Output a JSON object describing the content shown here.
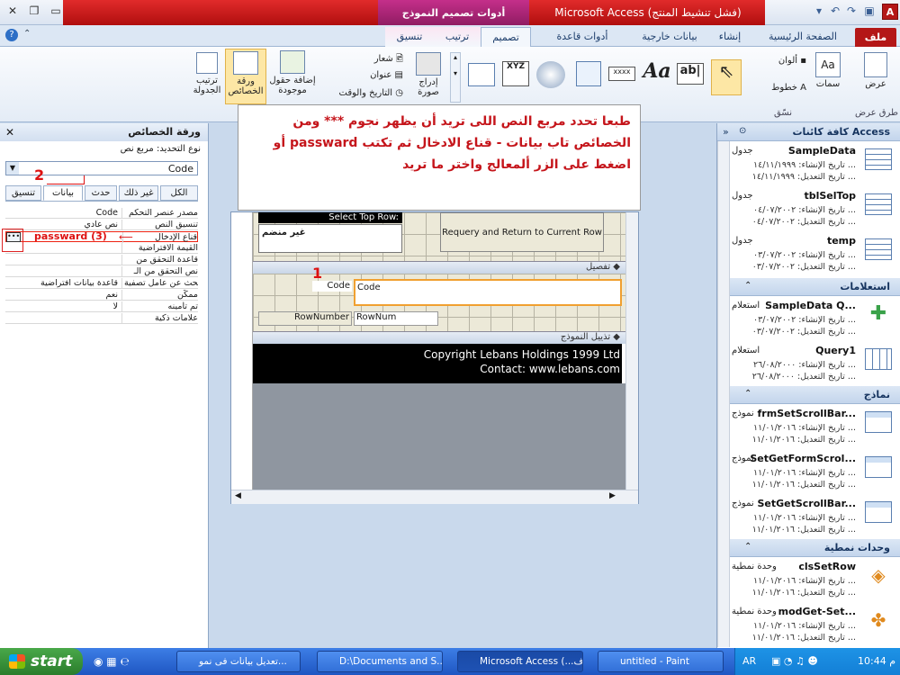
{
  "window": {
    "title": "Microsoft Access (فشل تنشيط المنتج)",
    "contextual_group": "أدوات تصميم النموذج"
  },
  "ribbon_tabs": [
    "ملف",
    "الصفحة الرئيسية",
    "إنشاء",
    "بيانات خارجية",
    "أدوات قاعدة البيانات",
    "تصميم",
    "ترتيب",
    "تنسيق"
  ],
  "ribbon": {
    "view_label": "عرض",
    "theme_labels": [
      "ألوان",
      "خطوط"
    ],
    "theme_group": "سمات",
    "view_group": "طرق عرض",
    "format_label": "نسّق",
    "insert_image": "إدراج صورة",
    "logo_label": "شعار",
    "title_label": "عنوان",
    "datetime_label": "التاريخ والوقت",
    "add_fields": "إضافة حقول موجودة",
    "property_sheet": "ورقة الخصائص",
    "tab_order": "ترتيب الجدولة",
    "controls_labels": [
      "Aa",
      "ab|",
      "xxxx",
      "XYZ"
    ]
  },
  "property_sheet": {
    "title": "ورقة الخصائص",
    "selection_type_label": "نوع التحديد:  مربع نص",
    "selected_control": "Code",
    "tabs": [
      "تنسيق",
      "بيانات",
      "حدث",
      "غير ذلك",
      "الكل"
    ],
    "rows": [
      {
        "name": "مصدر عنصر التحكم",
        "value": "Code"
      },
      {
        "name": "تنسيق النص",
        "value": "نص عادي"
      },
      {
        "name": "قناع الإدخال",
        "value": ""
      },
      {
        "name": "القيمة الافتراضية",
        "value": ""
      },
      {
        "name": "قاعدة التحقق من",
        "value": ""
      },
      {
        "name": "نص التحقق من الـ",
        "value": ""
      },
      {
        "name": "بحث عن عامل تصفية",
        "value": "قاعدة بيانات افتراضية"
      },
      {
        "name": "ممكّن",
        "value": "نعم"
      },
      {
        "name": "تم تأمينه",
        "value": "لا"
      },
      {
        "name": "علامات ذكية",
        "value": ""
      }
    ]
  },
  "annotation": {
    "line1": "طبعا تحدد مربع النص اللى تريد أن يظهر نجوم *** ومن",
    "line2": "أو passward الخصائص تاب بيانات - قناع الادخال ثم تكتب",
    "line3": "اضغط على الزر ألمعالج واختر ما تريد",
    "marker1": "1",
    "marker2": "2",
    "marker3": "passward (3)"
  },
  "form": {
    "header_label": "Select Top Row:",
    "header_value": "غير منضم",
    "requery_button": "Requery and Return to Current Row",
    "detail_section": "تفصيل",
    "code_label": "Code",
    "code_field": "Code",
    "rownum_label": "RowNumber",
    "rownum_field": "RowNum",
    "footer_section": "تذييل النموذج",
    "copyright1": "Copyright Lebans Holdings 1999 Ltd",
    "copyright2": "Contact: www.lebans.com"
  },
  "nav": {
    "title": "كافة كائنات Access",
    "groups": {
      "queries": "استعلامات",
      "forms": "نماذج",
      "modules": "وحدات نمطية"
    },
    "tables": [
      {
        "name": "SampleData",
        "type": "جدول",
        "d1": "تاريخ الإنشاء: ١٤/١١/١٩٩٩ ...",
        "d2": "تاريخ التعديل: ١٤/١١/١٩٩٩ ..."
      },
      {
        "name": "tblSelTop",
        "type": "جدول",
        "d1": "تاريخ الإنشاء: ٠٤/٠٧/٢٠٠٢ ...",
        "d2": "تاريخ التعديل: ٠٤/٠٧/٢٠٠٢ ..."
      },
      {
        "name": "temp",
        "type": "جدول",
        "d1": "تاريخ الإنشاء: ٠٣/٠٧/٢٠٠٢ ...",
        "d2": "تاريخ التعديل: ٠٣/٠٧/٢٠٠٢ ..."
      }
    ],
    "queries": [
      {
        "name": "SampleData Q...",
        "type": "استعلام",
        "d1": "تاريخ الإنشاء: ٠٣/٠٧/٢٠٠٢ ...",
        "d2": "تاريخ التعديل: ٠٣/٠٧/٢٠٠٢ ..."
      },
      {
        "name": "Query1",
        "type": "استعلام",
        "d1": "تاريخ الإنشاء: ٢٦/٠٨/٢٠٠٠ ...",
        "d2": "تاريخ التعديل: ٢٦/٠٨/٢٠٠٠ ..."
      }
    ],
    "forms": [
      {
        "name": "frmSetScrollBar...",
        "type": "نموذج",
        "d1": "تاريخ الإنشاء: ١١/٠١/٢٠١٦ ...",
        "d2": "تاريخ التعديل: ١١/٠١/٢٠١٦ ..."
      },
      {
        "name": "SetGetFormScrol...",
        "type": "نموذج",
        "d1": "تاريخ الإنشاء: ١١/٠١/٢٠١٦ ...",
        "d2": "تاريخ التعديل: ١١/٠١/٢٠١٦ ..."
      },
      {
        "name": "SetGetScrollBar...",
        "type": "نموذج",
        "d1": "تاريخ الإنشاء: ١١/٠١/٢٠١٦ ...",
        "d2": "تاريخ التعديل: ١١/٠١/٢٠١٦ ..."
      }
    ],
    "modules": [
      {
        "name": "clsSetRow",
        "type": "وحدة نمطية",
        "d1": "تاريخ الإنشاء: ١١/٠١/٢٠١٦ ...",
        "d2": "تاريخ التعديل: ١١/٠١/٢٠١٦ ..."
      },
      {
        "name": "modGet-Set...",
        "type": "وحدة نمطية",
        "d1": "تاريخ الإنشاء: ١١/٠١/٢٠١٦ ...",
        "d2": "تاريخ التعديل: ١١/٠١/٢٠١٦ ..."
      }
    ]
  },
  "taskbar": {
    "start": "start",
    "tasks": [
      "تعديل بيانات فى نمو...",
      "تعديل بيانات فى نمو...",
      "D:\\Documents and S...",
      "Microsoft Access (...ف",
      "untitled - Paint"
    ],
    "lang": "AR",
    "clock": "م 10:44"
  },
  "colors": {
    "access_red": "#b41717",
    "annotation_red": "#c5151b",
    "taskbar_blue": "#2a63cf"
  }
}
